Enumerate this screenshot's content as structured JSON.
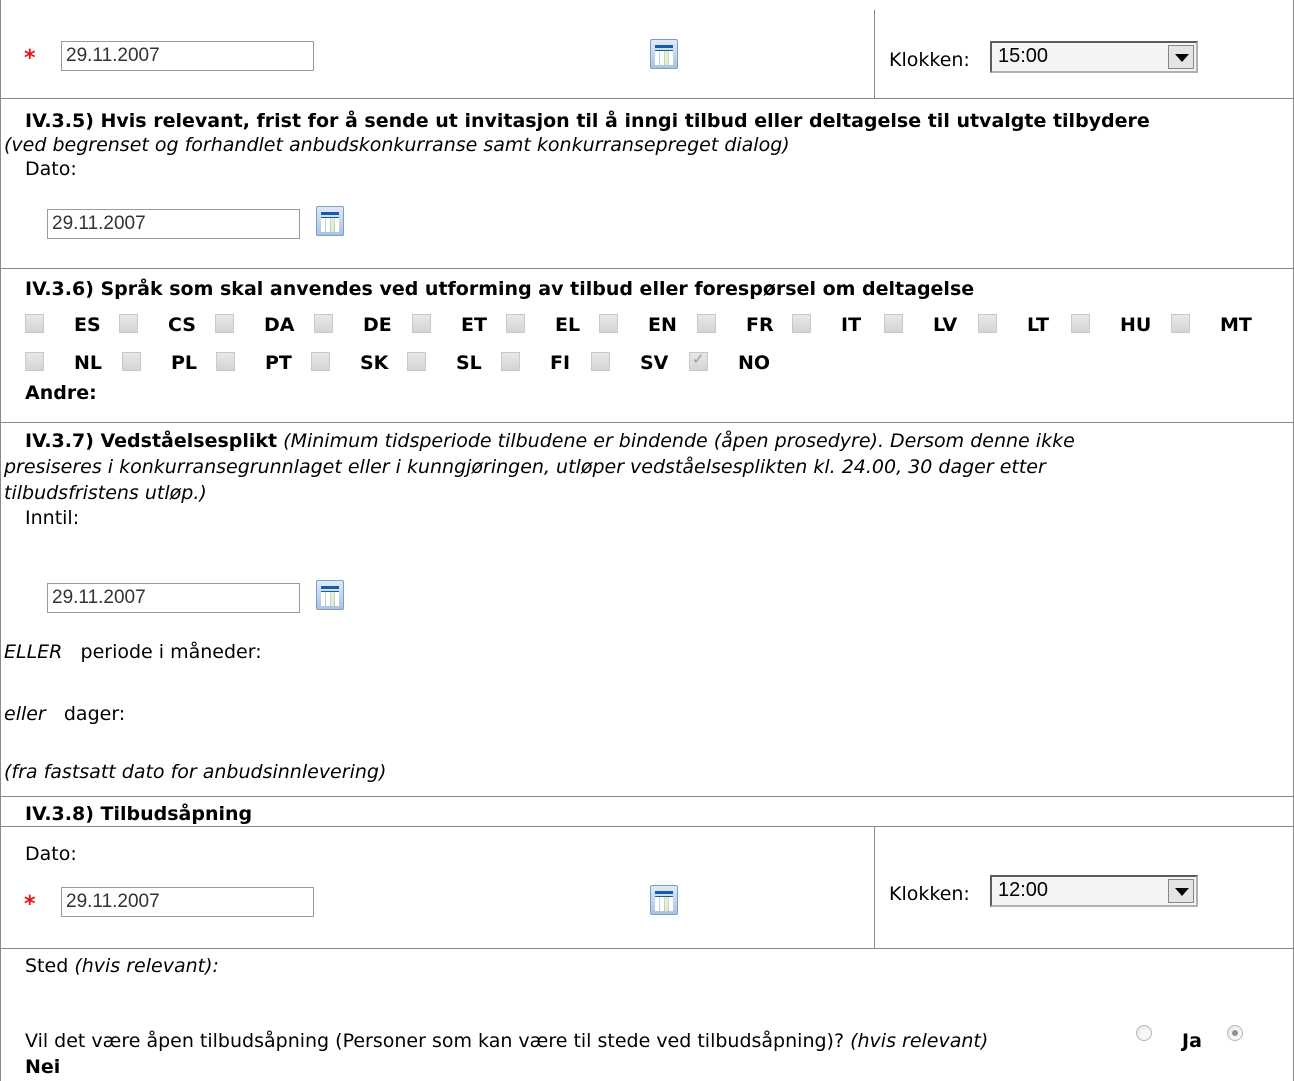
{
  "top": {
    "date_value": "29.11.2007",
    "time_label": "Klokken:",
    "time_value": "15:00"
  },
  "s435": {
    "heading": "IV.3.5) Hvis relevant, frist for å sende ut invitasjon til å inngi tilbud eller deltagelse til utvalgte tilbydere",
    "note": "(ved begrenset og forhandlet anbudskonkurranse samt konkurransepreget dialog)",
    "date_label": "Dato:",
    "date_value": "29.11.2007"
  },
  "s436": {
    "heading": "IV.3.6) Språk som skal anvendes ved utforming av tilbud eller forespørsel om deltagelse",
    "languages": [
      "ES",
      "CS",
      "DA",
      "DE",
      "ET",
      "EL",
      "EN",
      "FR",
      "IT",
      "LV",
      "LT",
      "HU",
      "MT",
      "NL",
      "PL",
      "PT",
      "SK",
      "SL",
      "FI",
      "SV",
      "NO"
    ],
    "checked": "NO",
    "other_label": "Andre:"
  },
  "s437": {
    "heading": "IV.3.7) Vedståelsesplikt",
    "note_line1": "(Minimum tidsperiode tilbudene er bindende (åpen prosedyre). Dersom denne ikke",
    "note_line2": "presiseres i konkurransegrunnlaget eller i kunngjøringen, utløper vedståelsesplikten kl. 24.00, 30 dager etter",
    "note_line3": "tilbudsfristens utløp.)",
    "until_label": "Inntil:",
    "date_value": "29.11.2007",
    "or_upper": "ELLER",
    "months_label": "periode i måneder:",
    "or_lower": "eller",
    "days_label": "dager:",
    "from_note": "(fra fastsatt dato for anbudsinnlevering)"
  },
  "s438": {
    "heading": "IV.3.8) Tilbudsåpning",
    "date_label": "Dato:",
    "date_value": "29.11.2007",
    "time_label": "Klokken:",
    "time_value": "12:00",
    "place_label": "Sted",
    "place_note": "(hvis relevant):",
    "open_question": "Vil det være åpen tilbudsåpning (Personer som kan være til stede ved tilbudsåpning)?",
    "open_note": "(hvis relevant)",
    "yes_label": "Ja",
    "no_label": "Nei",
    "selected": "Nei"
  }
}
